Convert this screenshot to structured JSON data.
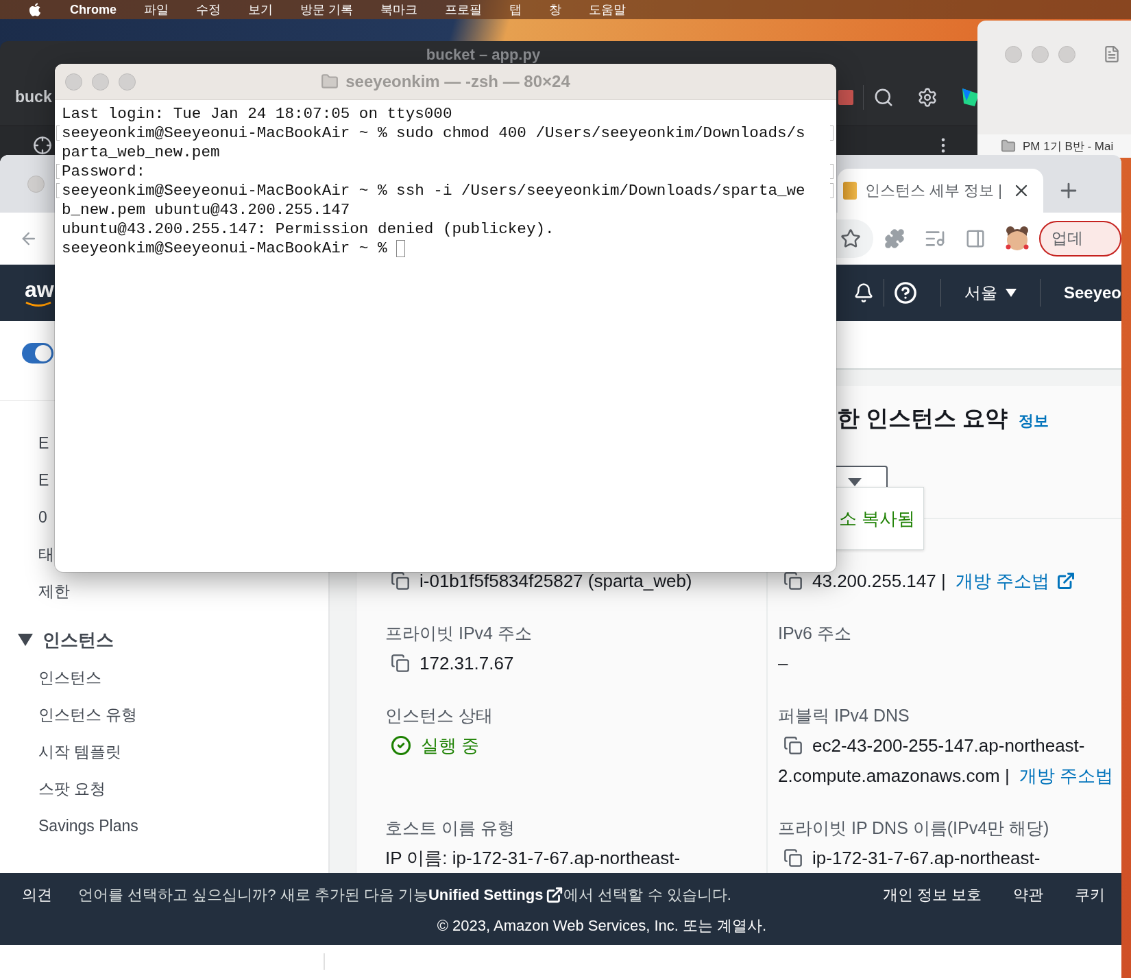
{
  "menu_bar": {
    "app": "Chrome",
    "items": [
      "파일",
      "수정",
      "보기",
      "방문 기록",
      "북마크",
      "프로필",
      "탭",
      "창",
      "도움말"
    ]
  },
  "editor_window": {
    "title": "bucket – app.py",
    "toolbar_label": "buck"
  },
  "finder_window": {
    "item": "PM 1기 B반 - Mai"
  },
  "browser": {
    "tab": {
      "title": "인스턴스 세부 정보 |",
      "selected": true
    },
    "update_button": "업데"
  },
  "aws": {
    "logo": "aw",
    "region": "서울",
    "account": "Seeyeo",
    "mode_toggle": {
      "on": true
    },
    "sidebar": {
      "items": [
        "E",
        "E",
        "0",
        "태",
        "제한"
      ],
      "sections": [
        {
          "label": "인스턴스",
          "expanded": true,
          "items": [
            "인스턴스",
            "인스턴스 유형",
            "시작 템플릿",
            "스팟 요청",
            "Savings Plans"
          ]
        }
      ]
    },
    "summary": {
      "title": "한 인스턴스 요약",
      "info_link": "정보",
      "copied_message": "소 복사됨",
      "rows": [
        [
          {
            "kind": "copy",
            "value": "i-01b1f5f5834f25827 (sparta_web)"
          },
          {
            "kind": "copy",
            "value": "43.200.255.147 |",
            "link": "개방 주소법",
            "external": true
          }
        ],
        [
          {
            "kind": "copy",
            "label": "프라이빗 IPv4 주소",
            "value": "172.31.7.67"
          },
          {
            "kind": "plain",
            "label": "IPv6 주소",
            "value": "–"
          }
        ],
        [
          {
            "kind": "status",
            "label": "인스턴스 상태",
            "value": "실행 중"
          },
          {
            "kind": "copy",
            "label": "퍼블릭 IPv4 DNS",
            "value": "ec2-43-200-255-147.ap-northeast-",
            "continuation": "2.compute.amazonaws.com |",
            "continuation_link": "개방 주소법"
          }
        ],
        [
          {
            "kind": "plain",
            "label": "호스트 이름 유형",
            "value": "IP 이름: ip-172-31-7-67.ap-northeast-"
          },
          {
            "kind": "copy",
            "label": "프라이빗 IP DNS 이름(IPv4만 해당)",
            "value": "ip-172-31-7-67.ap-northeast-"
          }
        ]
      ]
    },
    "footer": {
      "feedback": "의견",
      "notice_before": "언어를 선택하고 싶으십니까? 새로 추가된 다음 기능",
      "notice_link": "Unified Settings",
      "notice_after": "에서 선택할 수 있습니다.",
      "links": [
        "개인 정보 보호",
        "약관",
        "쿠키"
      ],
      "copyright": "© 2023, Amazon Web Services, Inc. 또는 계열사."
    }
  },
  "terminal": {
    "title": "seeyeonkim — -zsh — 80×24",
    "lines": [
      {
        "text": "Last login: Tue Jan 24 18:07:05 on ttys000",
        "marked": false,
        "cursor": false
      },
      {
        "text": "seeyeonkim@Seeyeonui-MacBookAir ~ % sudo chmod 400 /Users/seeyeonkim/Downloads/s",
        "marked": true,
        "cursor": false
      },
      {
        "text": "parta_web_new.pem",
        "marked": false,
        "cursor": false
      },
      {
        "text": "Password:",
        "marked": true,
        "cursor": false
      },
      {
        "text": "seeyeonkim@Seeyeonui-MacBookAir ~ % ssh -i /Users/seeyeonkim/Downloads/sparta_we",
        "marked": true,
        "cursor": false
      },
      {
        "text": "b_new.pem ubuntu@43.200.255.147",
        "marked": false,
        "cursor": false
      },
      {
        "text": "ubuntu@43.200.255.147: Permission denied (publickey).",
        "marked": false,
        "cursor": false
      },
      {
        "text": "seeyeonkim@Seeyeonui-MacBookAir ~ %",
        "marked": false,
        "cursor": true
      }
    ]
  }
}
